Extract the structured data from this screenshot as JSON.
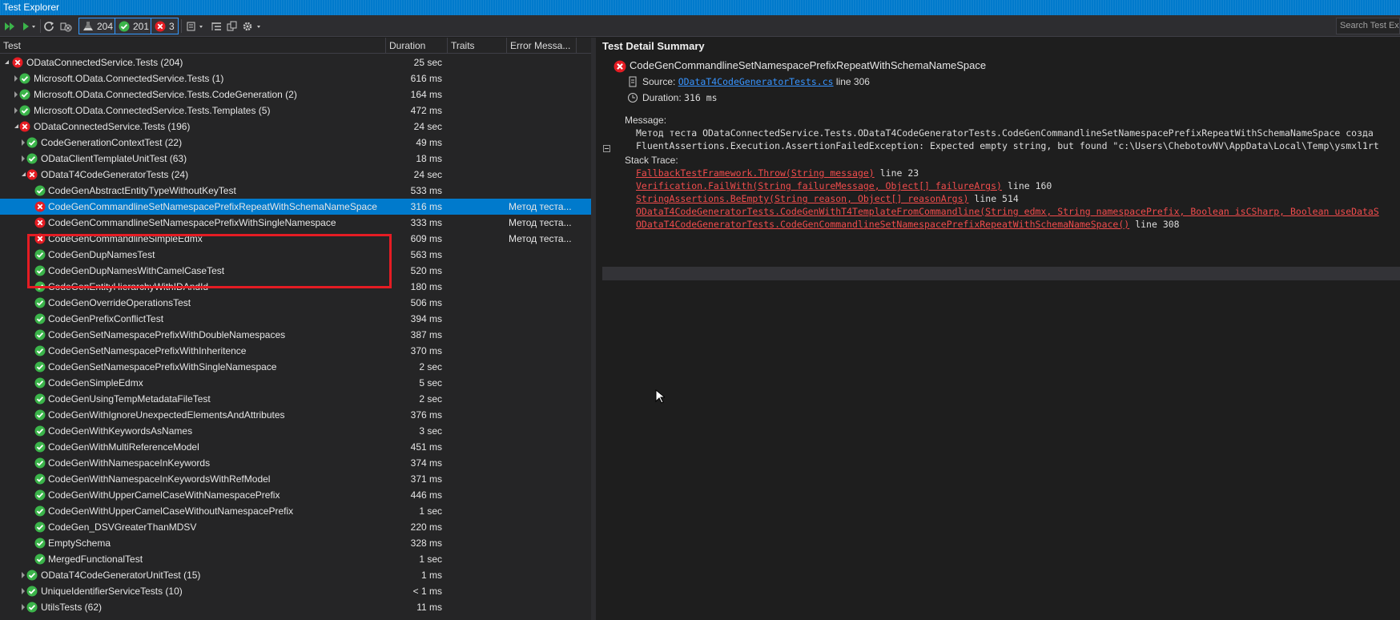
{
  "window": {
    "title": "Test Explorer"
  },
  "toolbar": {
    "counts": {
      "total": "204",
      "passed": "201",
      "failed": "3"
    },
    "search_placeholder": "Search Test Explorer"
  },
  "columns": {
    "test": "Test",
    "duration": "Duration",
    "traits": "Traits",
    "error": "Error Messa..."
  },
  "tree": [
    {
      "name": "ODataConnectedService.Tests (204)",
      "duration": "25 sec",
      "status": "failed",
      "level": 0,
      "expand": "open",
      "error": ""
    },
    {
      "name": "Microsoft.OData.ConnectedService.Tests (1)",
      "duration": "616 ms",
      "status": "passed",
      "level": 1,
      "expand": "closed",
      "error": ""
    },
    {
      "name": "Microsoft.OData.ConnectedService.Tests.CodeGeneration (2)",
      "duration": "164 ms",
      "status": "passed",
      "level": 1,
      "expand": "closed",
      "error": ""
    },
    {
      "name": "Microsoft.OData.ConnectedService.Tests.Templates (5)",
      "duration": "472 ms",
      "status": "passed",
      "level": 1,
      "expand": "closed",
      "error": ""
    },
    {
      "name": "ODataConnectedService.Tests (196)",
      "duration": "24 sec",
      "status": "failed",
      "level": 1,
      "expand": "open",
      "error": ""
    },
    {
      "name": "CodeGenerationContextTest (22)",
      "duration": "49 ms",
      "status": "passed",
      "level": 2,
      "expand": "closed",
      "error": ""
    },
    {
      "name": "ODataClientTemplateUnitTest (63)",
      "duration": "18 ms",
      "status": "passed",
      "level": 2,
      "expand": "closed",
      "error": ""
    },
    {
      "name": "ODataT4CodeGeneratorTests (24)",
      "duration": "24 sec",
      "status": "failed",
      "level": 2,
      "expand": "open",
      "error": ""
    },
    {
      "name": "CodeGenAbstractEntityTypeWithoutKeyTest",
      "duration": "533 ms",
      "status": "passed",
      "level": 3,
      "expand": "",
      "error": ""
    },
    {
      "name": "CodeGenCommandlineSetNamespacePrefixRepeatWithSchemaNameSpace",
      "duration": "316 ms",
      "status": "failed",
      "level": 3,
      "expand": "",
      "error": "Метод теста...",
      "selected": true
    },
    {
      "name": "CodeGenCommandlineSetNamespacePrefixWithSingleNamespace",
      "duration": "333 ms",
      "status": "failed",
      "level": 3,
      "expand": "",
      "error": "Метод теста..."
    },
    {
      "name": "CodeGenCommandlineSimpleEdmx",
      "duration": "609 ms",
      "status": "failed",
      "level": 3,
      "expand": "",
      "error": "Метод теста..."
    },
    {
      "name": "CodeGenDupNamesTest",
      "duration": "563 ms",
      "status": "passed",
      "level": 3,
      "expand": "",
      "error": ""
    },
    {
      "name": "CodeGenDupNamesWithCamelCaseTest",
      "duration": "520 ms",
      "status": "passed",
      "level": 3,
      "expand": "",
      "error": ""
    },
    {
      "name": "CodeGenEntityHierarchyWithIDAndId",
      "duration": "180 ms",
      "status": "passed",
      "level": 3,
      "expand": "",
      "error": ""
    },
    {
      "name": "CodeGenOverrideOperationsTest",
      "duration": "506 ms",
      "status": "passed",
      "level": 3,
      "expand": "",
      "error": ""
    },
    {
      "name": "CodeGenPrefixConflictTest",
      "duration": "394 ms",
      "status": "passed",
      "level": 3,
      "expand": "",
      "error": ""
    },
    {
      "name": "CodeGenSetNamespacePrefixWithDoubleNamespaces",
      "duration": "387 ms",
      "status": "passed",
      "level": 3,
      "expand": "",
      "error": ""
    },
    {
      "name": "CodeGenSetNamespacePrefixWithInheritence",
      "duration": "370 ms",
      "status": "passed",
      "level": 3,
      "expand": "",
      "error": ""
    },
    {
      "name": "CodeGenSetNamespacePrefixWithSingleNamespace",
      "duration": "2 sec",
      "status": "passed",
      "level": 3,
      "expand": "",
      "error": ""
    },
    {
      "name": "CodeGenSimpleEdmx",
      "duration": "5 sec",
      "status": "passed",
      "level": 3,
      "expand": "",
      "error": ""
    },
    {
      "name": "CodeGenUsingTempMetadataFileTest",
      "duration": "2 sec",
      "status": "passed",
      "level": 3,
      "expand": "",
      "error": ""
    },
    {
      "name": "CodeGenWithIgnoreUnexpectedElementsAndAttributes",
      "duration": "376 ms",
      "status": "passed",
      "level": 3,
      "expand": "",
      "error": ""
    },
    {
      "name": "CodeGenWithKeywordsAsNames",
      "duration": "3 sec",
      "status": "passed",
      "level": 3,
      "expand": "",
      "error": ""
    },
    {
      "name": "CodeGenWithMultiReferenceModel",
      "duration": "451 ms",
      "status": "passed",
      "level": 3,
      "expand": "",
      "error": ""
    },
    {
      "name": "CodeGenWithNamespaceInKeywords",
      "duration": "374 ms",
      "status": "passed",
      "level": 3,
      "expand": "",
      "error": ""
    },
    {
      "name": "CodeGenWithNamespaceInKeywordsWithRefModel",
      "duration": "371 ms",
      "status": "passed",
      "level": 3,
      "expand": "",
      "error": ""
    },
    {
      "name": "CodeGenWithUpperCamelCaseWithNamespacePrefix",
      "duration": "446 ms",
      "status": "passed",
      "level": 3,
      "expand": "",
      "error": ""
    },
    {
      "name": "CodeGenWithUpperCamelCaseWithoutNamespacePrefix",
      "duration": "1 sec",
      "status": "passed",
      "level": 3,
      "expand": "",
      "error": ""
    },
    {
      "name": "CodeGen_DSVGreaterThanMDSV",
      "duration": "220 ms",
      "status": "passed",
      "level": 3,
      "expand": "",
      "error": ""
    },
    {
      "name": "EmptySchema",
      "duration": "328 ms",
      "status": "passed",
      "level": 3,
      "expand": "",
      "error": ""
    },
    {
      "name": "MergedFunctionalTest",
      "duration": "1 sec",
      "status": "passed",
      "level": 3,
      "expand": "",
      "error": ""
    },
    {
      "name": "ODataT4CodeGeneratorUnitTest (15)",
      "duration": "1 ms",
      "status": "passed",
      "level": 2,
      "expand": "closed",
      "error": ""
    },
    {
      "name": "UniqueIdentifierServiceTests (10)",
      "duration": "< 1 ms",
      "status": "passed",
      "level": 2,
      "expand": "closed",
      "error": ""
    },
    {
      "name": "UtilsTests (62)",
      "duration": "11 ms",
      "status": "passed",
      "level": 2,
      "expand": "closed",
      "error": ""
    }
  ],
  "detail": {
    "title": "Test Detail Summary",
    "test_name": "CodeGenCommandlineSetNamespacePrefixRepeatWithSchemaNameSpace",
    "source_label": "Source:",
    "source_file": "ODataT4CodeGeneratorTests.cs",
    "source_line": "line 306",
    "duration_label": "Duration:",
    "duration_value": "316 ms",
    "message_label": "Message:",
    "message_line1": "Метод теста ODataConnectedService.Tests.ODataT4CodeGeneratorTests.CodeGenCommandlineSetNamespacePrefixRepeatWithSchemaNameSpace созда",
    "message_line2": "FluentAssertions.Execution.AssertionFailedException: Expected empty string, but found \"c:\\Users\\ChebotovNV\\AppData\\Local\\Temp\\ysmxl1rt",
    "stack_label": "Stack Trace:",
    "stack": [
      {
        "call": "FallbackTestFramework.Throw(String message)",
        "line": "line 23"
      },
      {
        "call": "Verification.FailWith(String failureMessage, Object[] failureArgs)",
        "line": "line 160"
      },
      {
        "call": "StringAssertions.BeEmpty(String reason, Object[] reasonArgs)",
        "line": "line 514"
      },
      {
        "call": "ODataT4CodeGeneratorTests.CodeGenWithT4TemplateFromCommandline(String edmx, String namespacePrefix, Boolean isCSharp, Boolean useDataS",
        "line": ""
      },
      {
        "call": "ODataT4CodeGeneratorTests.CodeGenCommandlineSetNamespacePrefixRepeatWithSchemaNameSpace()",
        "line": "line 308"
      }
    ]
  },
  "colors": {
    "accent": "#007acc",
    "passed": "#3bb44a",
    "failed": "#e51c23",
    "link": "#3794ff",
    "trace": "#f14c4c"
  }
}
